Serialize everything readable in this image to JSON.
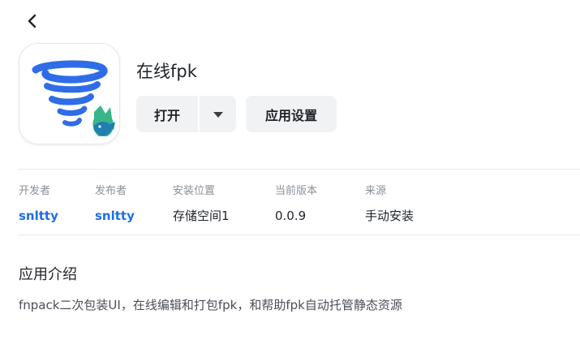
{
  "app": {
    "name": "在线fpk",
    "icon": "tornado-app-icon"
  },
  "actions": {
    "open_label": "打开",
    "settings_label": "应用设置"
  },
  "meta": [
    {
      "label": "开发者",
      "value": "snltty",
      "is_link": true
    },
    {
      "label": "发布者",
      "value": "snltty",
      "is_link": true
    },
    {
      "label": "安装位置",
      "value": "存储空间1",
      "is_link": false
    },
    {
      "label": "当前版本",
      "value": "0.0.9",
      "is_link": false
    },
    {
      "label": "来源",
      "value": "手动安装",
      "is_link": false
    }
  ],
  "intro": {
    "title": "应用介绍",
    "text": "fnpack二次包装UI，在线编辑和打包fpk，和帮助fpk自动托管静态资源"
  },
  "colors": {
    "link": "#1f6fe5",
    "button_bg": "#f1f2f4",
    "icon_blue": "#2f6de8"
  }
}
